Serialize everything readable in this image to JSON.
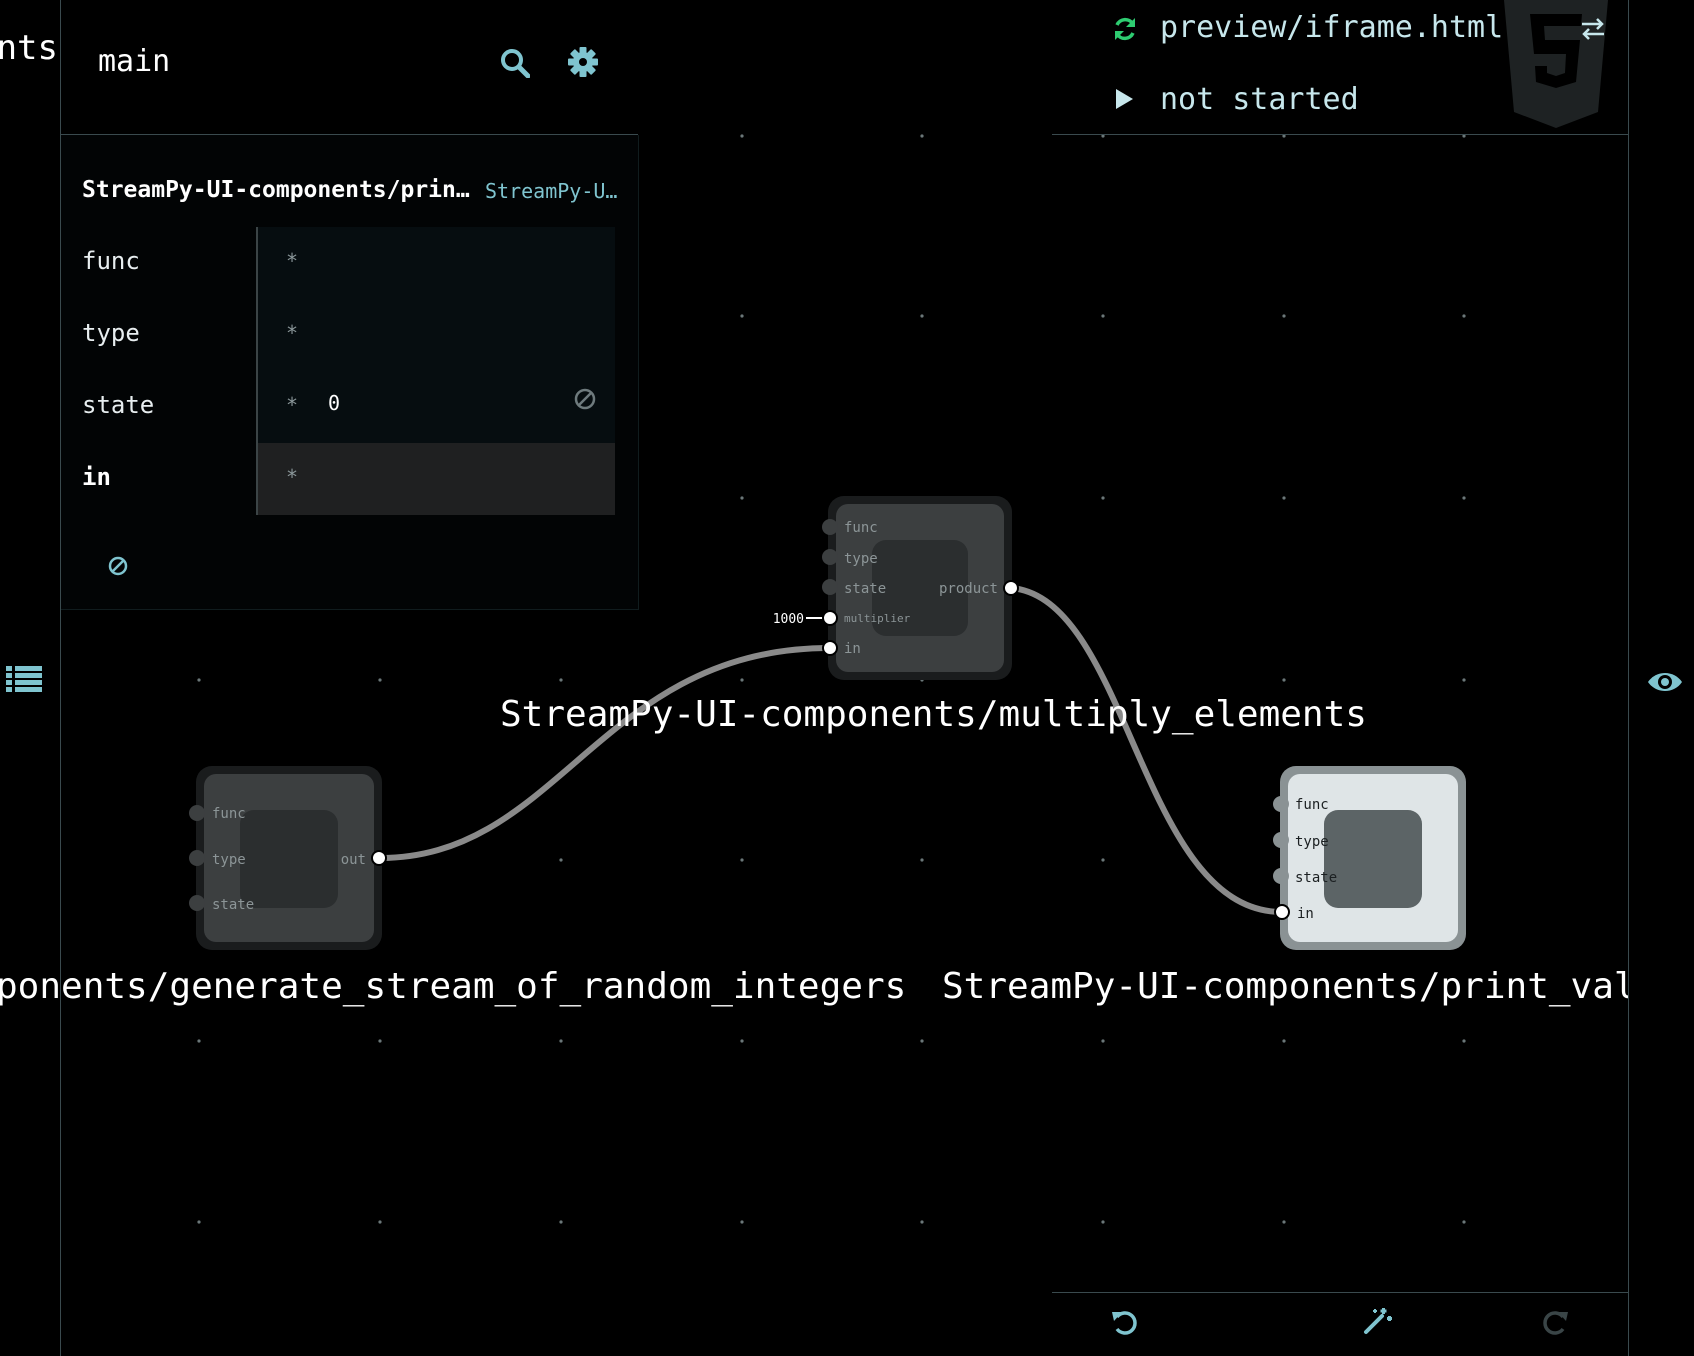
{
  "sidebar": {
    "left_label": "nts",
    "branch": "main"
  },
  "inspector": {
    "title": "StreamPy-UI-components/print…",
    "subtitle": "StreamPy-U…",
    "rows": [
      {
        "label": "func",
        "star": "*",
        "value": ""
      },
      {
        "label": "type",
        "star": "*",
        "value": ""
      },
      {
        "label": "state",
        "star": "*",
        "value": "0"
      },
      {
        "label": "in",
        "star": "*",
        "value": ""
      }
    ]
  },
  "preview": {
    "file": "preview/iframe.html",
    "status": "not started"
  },
  "graph": {
    "nodes": {
      "multiply": {
        "label": "StreamPy-UI-components/multiply_elements",
        "inports": [
          "func",
          "type",
          "state",
          "multiplier",
          "in"
        ],
        "outports": [
          "product"
        ],
        "iip_value": "1000"
      },
      "generate": {
        "label": "ponents/generate_stream_of_random_integers",
        "inports": [
          "func",
          "type",
          "state"
        ],
        "outports": [
          "out"
        ]
      },
      "print": {
        "label": "StreamPy-UI-components/print_value_s",
        "inports": [
          "func",
          "type",
          "state",
          "in"
        ],
        "outports": []
      }
    }
  },
  "icons": {
    "list": "list-icon",
    "search": "search-icon",
    "settings": "gear-icon",
    "eye": "eye-icon",
    "html5": "html5-icon",
    "refresh": "refresh-icon",
    "swap": "swap-icon",
    "play": "play-icon",
    "undo": "undo-icon",
    "autolayout": "wand-icon",
    "redo": "redo-icon",
    "clear": "block-icon"
  },
  "colors": {
    "background": "#000000",
    "accent": "#7fc4cf",
    "refresh_green": "#2ecc71",
    "edge": "#8a8a8a",
    "node_dark": "#3c3f40",
    "node_selected": "#dfe5e7"
  }
}
